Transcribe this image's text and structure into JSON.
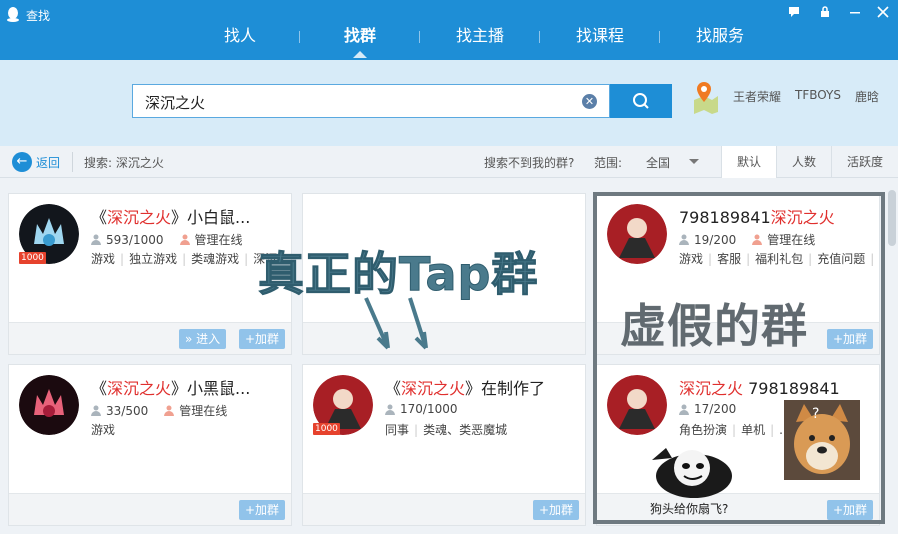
{
  "app": {
    "title": "查找"
  },
  "tabs": [
    {
      "label": "找人"
    },
    {
      "label": "找群"
    },
    {
      "label": "找主播"
    },
    {
      "label": "找课程"
    },
    {
      "label": "找服务"
    }
  ],
  "search": {
    "value": "深沉之火"
  },
  "hot_links": [
    "王者荣耀",
    "TFBOYS",
    "鹿晗"
  ],
  "filter": {
    "back_label": "返回",
    "search_label": "搜索: 深沉之火",
    "not_found": "搜索不到我的群?",
    "scope_label": "范围:",
    "scope_value": "全国",
    "sort_tabs": [
      "默认",
      "人数",
      "活跃度"
    ]
  },
  "cards": [
    {
      "name_pre": "《",
      "name_hl": "深沉之火",
      "name_post": "》小白鼠...",
      "members": "593/1000",
      "admin": "管理在线",
      "tags": [
        "游戏",
        "独立游戏",
        "类魂游戏",
        "深沉"
      ],
      "badge": "1000",
      "enter_label": "» 进入",
      "join_label": "+加群"
    },
    {
      "name_pre": "",
      "name_hl": "",
      "name_post": "",
      "members": "",
      "admin": "",
      "tags": [],
      "join_label": ""
    },
    {
      "name_pre": "798189841",
      "name_hl": "深沉之火",
      "name_post": "",
      "members": "19/200",
      "admin": "管理在线",
      "tags": [
        "游戏",
        "客服",
        "福利礼包",
        "充值问题",
        "..."
      ],
      "join_label": "+加群"
    },
    {
      "name_pre": "《",
      "name_hl": "深沉之火",
      "name_post": "》小黑鼠...",
      "members": "33/500",
      "admin": "管理在线",
      "tags": [
        "游戏"
      ],
      "join_label": "+加群"
    },
    {
      "name_pre": "《",
      "name_hl": "深沉之火",
      "name_post": "》在制作了",
      "members": "170/1000",
      "admin": "",
      "tags": [
        "同事",
        "类魂、类恶魔城"
      ],
      "badge": "1000",
      "join_label": "+加群"
    },
    {
      "name_pre": "",
      "name_hl": "深沉之火",
      "name_post": " 798189841",
      "members": "17/200",
      "admin": "",
      "tags": [
        "角色扮演",
        "单机",
        "..."
      ],
      "join_label": "+加群"
    }
  ],
  "annotations": {
    "real": "真正的Tap群",
    "fake": "虚假的群",
    "meme": "狗头给你扇飞?",
    "doge_q": "?"
  },
  "colors": {
    "accent": "#1e8ed6",
    "highlight": "#e0302e",
    "frame": "#6e7980"
  }
}
